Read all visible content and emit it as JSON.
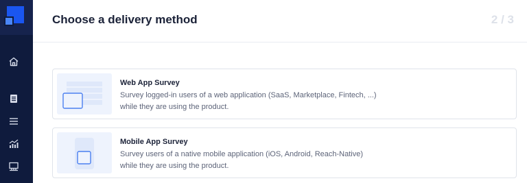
{
  "header": {
    "title": "Choose a delivery method",
    "step": "2 / 3"
  },
  "sidebar": {
    "items": [
      {
        "icon": "home-icon"
      },
      {
        "icon": "document-icon"
      },
      {
        "icon": "menu-icon"
      },
      {
        "icon": "analytics-icon"
      },
      {
        "icon": "integrations-icon"
      }
    ]
  },
  "options": [
    {
      "title": "Web App Survey",
      "description_line1": "Survey logged-in users of a web application (SaaS, Marketplace, Fintech, ...)",
      "description_line2": "while they are using the product.",
      "icon": "web-app-illustration"
    },
    {
      "title": "Mobile App Survey",
      "description_line1": "Survey users of a native mobile application (iOS, Android, Reach-Native)",
      "description_line2": "while they are using the product.",
      "icon": "mobile-app-illustration"
    }
  ]
}
